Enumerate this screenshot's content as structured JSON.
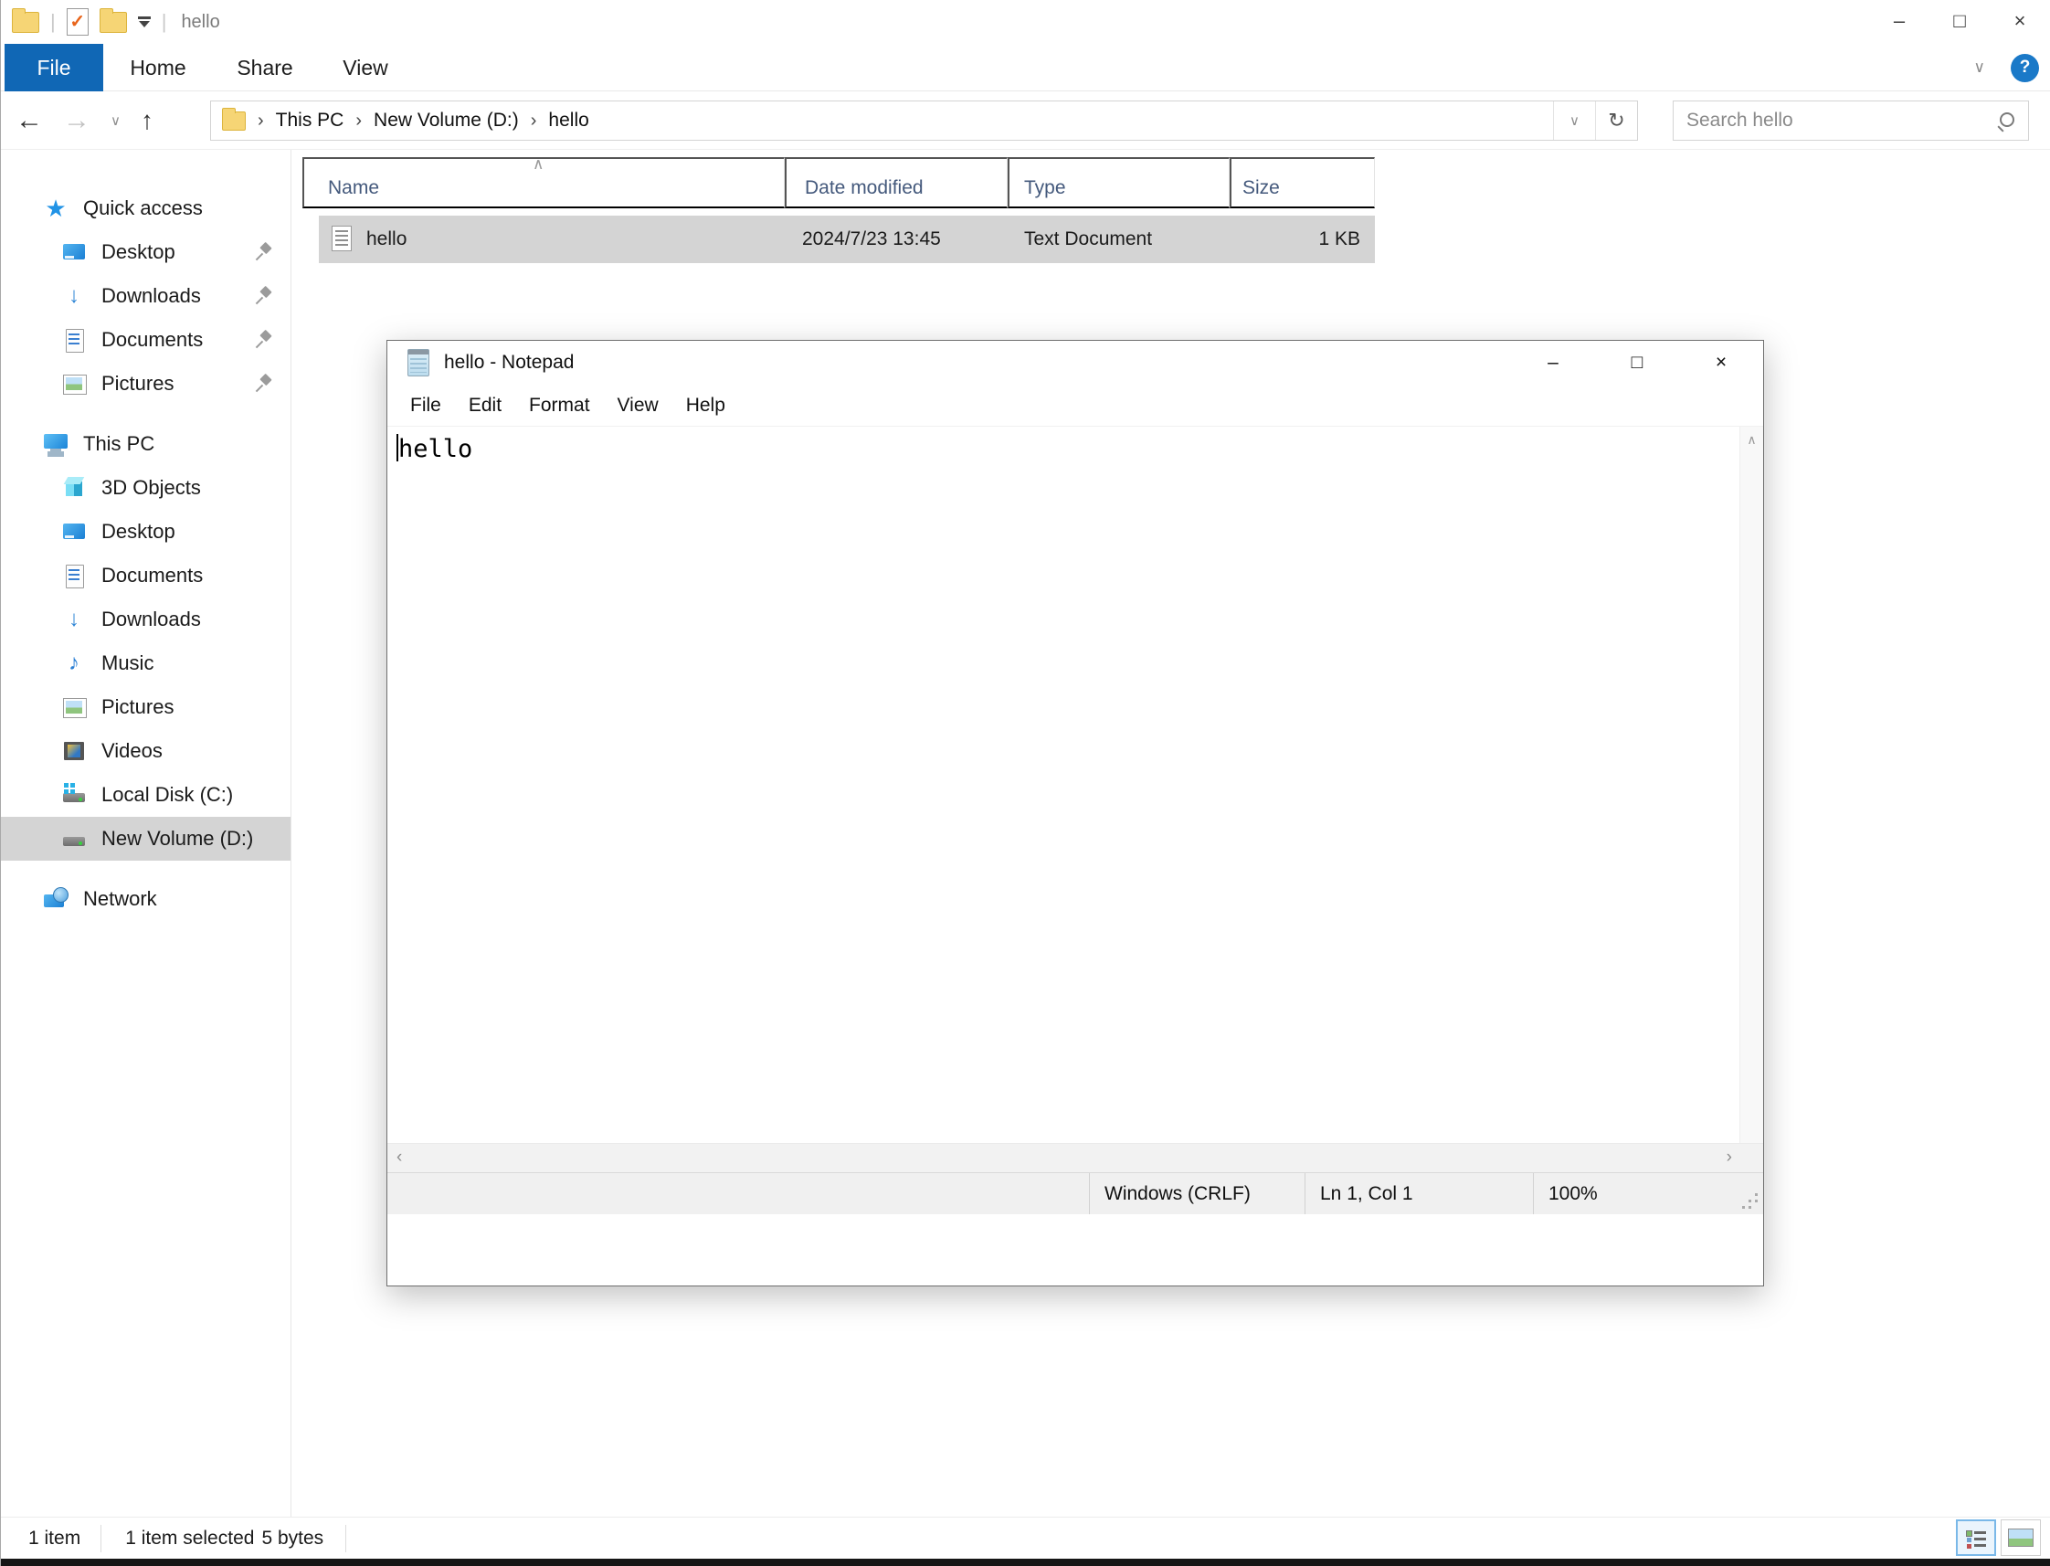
{
  "colors": {
    "accent_blue": "#1067b5",
    "selection_gray": "#d4d4d4",
    "help_blue": "#1a79c8",
    "file_tab_text": "#ffffff"
  },
  "icons": {
    "back_arrow": "←",
    "forward_arrow": "→",
    "up_arrow": "↑",
    "chevron_down": "∨",
    "chevron_up": "∧",
    "scroll_left": "‹",
    "scroll_right": "›",
    "breadcrumb_separator": "›",
    "refresh": "↻",
    "help": "?",
    "minimize": "–",
    "maximize": "□",
    "close": "×",
    "check": "✓",
    "star": "★",
    "download_arrow": "↓",
    "music_note": "♪",
    "separator": "|"
  },
  "explorer": {
    "window_title": "hello",
    "tabs": [
      {
        "label": "File"
      },
      {
        "label": "Home"
      },
      {
        "label": "Share"
      },
      {
        "label": "View"
      }
    ],
    "breadcrumbs": [
      {
        "label": "This PC"
      },
      {
        "label": "New Volume (D:)"
      },
      {
        "label": "hello"
      }
    ],
    "search": {
      "placeholder": "Search hello"
    },
    "columns": [
      {
        "label": "Name"
      },
      {
        "label": "Date modified"
      },
      {
        "label": "Type"
      },
      {
        "label": "Size"
      }
    ],
    "files": [
      {
        "name": "hello",
        "date_modified": "2024/7/23 13:45",
        "type": "Text Document",
        "size": "1 KB"
      }
    ],
    "sidebar": {
      "items": [
        {
          "label": "Quick access"
        },
        {
          "label": "Desktop"
        },
        {
          "label": "Downloads"
        },
        {
          "label": "Documents"
        },
        {
          "label": "Pictures"
        },
        {
          "label": "This PC"
        },
        {
          "label": "3D Objects"
        },
        {
          "label": "Desktop"
        },
        {
          "label": "Documents"
        },
        {
          "label": "Downloads"
        },
        {
          "label": "Music"
        },
        {
          "label": "Pictures"
        },
        {
          "label": "Videos"
        },
        {
          "label": "Local Disk (C:)"
        },
        {
          "label": "New Volume (D:)"
        },
        {
          "label": "Network"
        }
      ]
    },
    "statusbar": {
      "item_count": "1 item",
      "selection": "1 item selected",
      "selection_size": "5 bytes"
    }
  },
  "notepad": {
    "title": "hello - Notepad",
    "menus": [
      {
        "label": "File"
      },
      {
        "label": "Edit"
      },
      {
        "label": "Format"
      },
      {
        "label": "View"
      },
      {
        "label": "Help"
      }
    ],
    "content": "hello",
    "statusbar": {
      "line_ending": "Windows (CRLF)",
      "cursor_position": "Ln 1, Col 1",
      "zoom": "100%"
    }
  }
}
